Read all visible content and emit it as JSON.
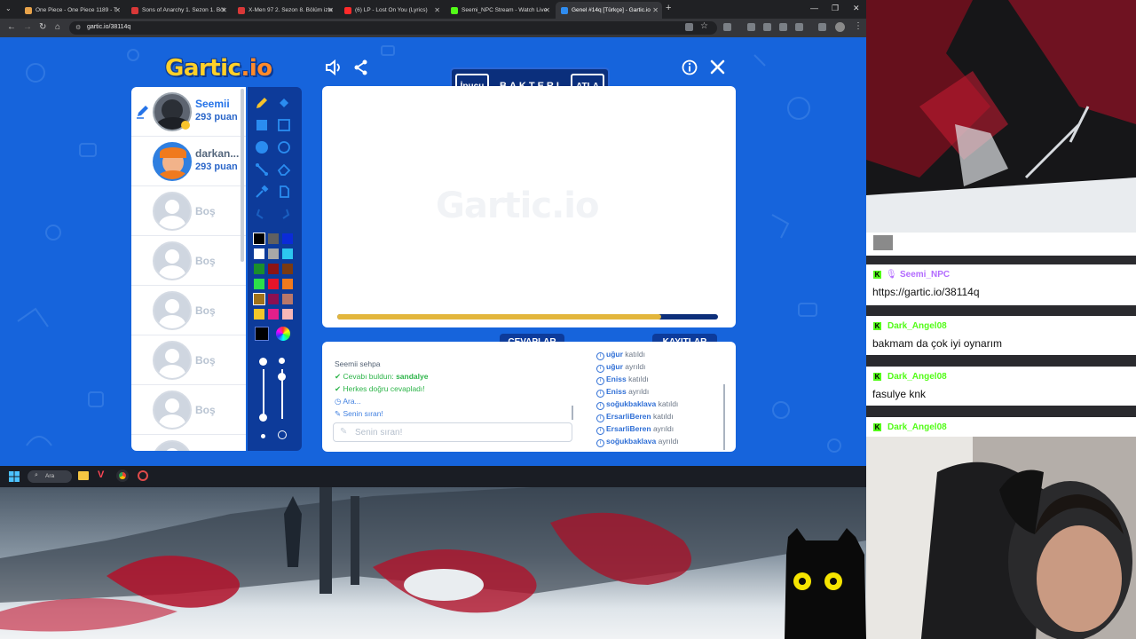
{
  "browser": {
    "tabs": [
      {
        "label": "One Piece - One Piece 1189 - T",
        "color": "#e8a34a"
      },
      {
        "label": "Sons of Anarchy 1. Sezon 1. Böl",
        "color": "#d93838"
      },
      {
        "label": "X-Men 97 2. Sezon 8. Bölüm izle",
        "color": "#d93838"
      },
      {
        "label": "(6) LP - Lost On You (Lyrics)",
        "color": "#ff2a2a"
      },
      {
        "label": "Seemi_NPC Stream - Watch Live",
        "color": "#53fc18"
      },
      {
        "label": "Genel #14q [Türkçe] - Gartic.io",
        "color": "#2f8cf0"
      }
    ],
    "url": "gartic.io/38114q"
  },
  "game": {
    "logo_main": "Gartic",
    "logo_io": ".io",
    "watermark": "Gartic.io",
    "hint_button": "İpucu",
    "word": "BAKTERI",
    "skip_button": "ATLA",
    "timer_progress": 0.85,
    "players": [
      {
        "name": "Seemii",
        "points": "293 puan",
        "avatar": "photo"
      },
      {
        "name": "darkan...",
        "points": "293 puan",
        "avatar": "cartoon"
      },
      {
        "name": "Boş"
      },
      {
        "name": "Boş"
      },
      {
        "name": "Boş"
      },
      {
        "name": "Boş"
      },
      {
        "name": "Boş"
      }
    ],
    "palette": [
      [
        "#000000",
        "#606060",
        "#0b2bd8"
      ],
      [
        "#ffffff",
        "#a8a8a8",
        "#2cc6f0"
      ],
      [
        "#1a8f2b",
        "#8c1414",
        "#7a3a12"
      ],
      [
        "#2cdf4a",
        "#e6142a",
        "#f07a1e"
      ],
      [
        "#a0721a",
        "#8c1052",
        "#b8776a"
      ],
      [
        "#f3c62a",
        "#e41f8a",
        "#f7b7b7"
      ]
    ],
    "answers_title": "CEVAPLAR",
    "logs_title": "KAYITLAR",
    "answers": [
      {
        "user": "Seemii",
        "text": "sehpa",
        "type": "chat"
      },
      {
        "icon": "✔",
        "text": "Cevabı buldun:",
        "word": "sandalye",
        "type": "green"
      },
      {
        "icon": "✔",
        "text": "Herkes doğru cevapladı!",
        "type": "green"
      },
      {
        "icon": "◷",
        "text": "Ara...",
        "type": "blue"
      },
      {
        "icon": "✎",
        "text": "Senin sıran!",
        "type": "blue"
      }
    ],
    "answer_placeholder": "Senin sıran!",
    "logs": [
      {
        "user": "uğur",
        "action": "katıldı"
      },
      {
        "user": "uğur",
        "action": "ayrıldı"
      },
      {
        "user": "Eniss",
        "action": "katıldı"
      },
      {
        "user": "Eniss",
        "action": "ayrıldı"
      },
      {
        "user": "soğukbaklava",
        "action": "katıldı"
      },
      {
        "user": "ErsarliBeren",
        "action": "katıldı"
      },
      {
        "user": "ErsarliBeren",
        "action": "ayrıldı"
      },
      {
        "user": "soğukbaklava",
        "action": "ayrıldı"
      }
    ]
  },
  "taskbar": {
    "search_label": "Ara"
  },
  "chat": {
    "messages": [
      {
        "user": "Seemi_NPC",
        "user_color": "#b36bff",
        "text": "https://gartic.io/38114q",
        "has_mic": true
      },
      {
        "user": "Dark_Angel08",
        "user_color": "#53fc18",
        "text": "bakmam da çok iyi oynarım"
      },
      {
        "user": "Dark_Angel08",
        "user_color": "#53fc18",
        "text": "fasulye knk"
      },
      {
        "user": "Dark_Angel08",
        "user_color": "#53fc18",
        "text": ""
      }
    ]
  }
}
